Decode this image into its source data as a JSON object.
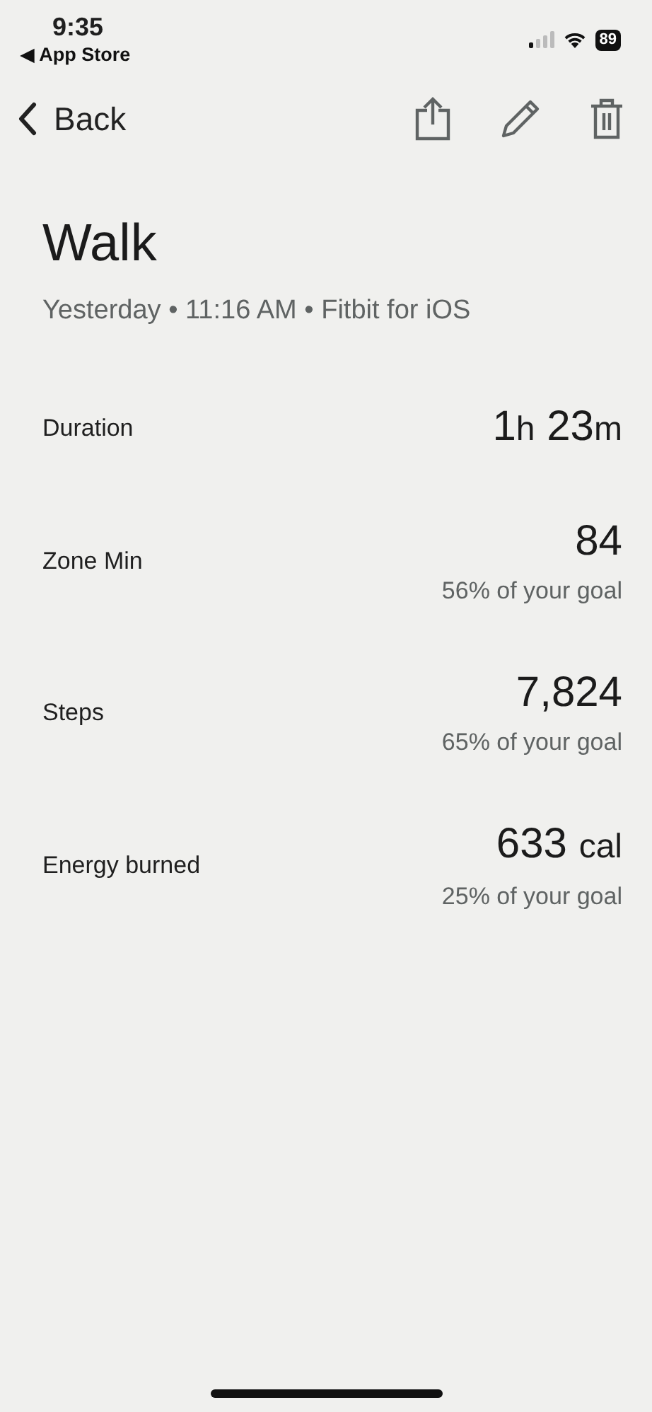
{
  "status_bar": {
    "time": "9:35",
    "back_app": "◀ App Store",
    "battery": "89"
  },
  "nav": {
    "back": "Back"
  },
  "activity": {
    "title": "Walk",
    "subtitle": "Yesterday • 11:16 AM • Fitbit for iOS"
  },
  "metrics": [
    {
      "label": "Duration",
      "value_parts": [
        {
          "text": "1",
          "kind": "number"
        },
        {
          "text": "h",
          "kind": "unit"
        },
        {
          "text": "23",
          "kind": "spaced_number"
        },
        {
          "text": "m",
          "kind": "unit"
        }
      ]
    },
    {
      "label": "Zone Min",
      "value_parts": [
        {
          "text": "84",
          "kind": "number"
        }
      ],
      "goal": "56% of your goal"
    },
    {
      "label": "Steps",
      "value_parts": [
        {
          "text": "7,824",
          "kind": "number"
        }
      ],
      "goal": "65% of your goal"
    },
    {
      "label": "Energy burned",
      "value_parts": [
        {
          "text": "633",
          "kind": "number"
        },
        {
          "text": "cal",
          "kind": "spaced_unit"
        }
      ],
      "goal": "25% of your goal"
    }
  ]
}
